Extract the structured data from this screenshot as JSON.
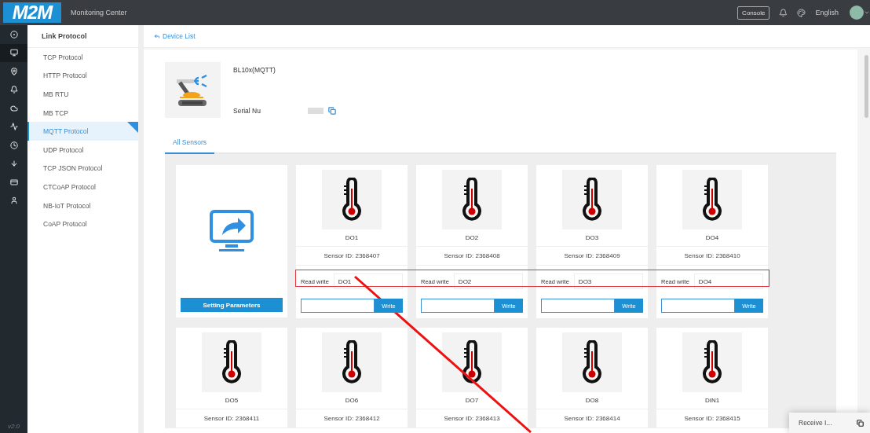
{
  "header": {
    "logo": "M2M",
    "title": "Monitoring Center",
    "console_button": "Console",
    "language": "English"
  },
  "rail": {
    "items": [
      {
        "selected": false
      },
      {
        "selected": true
      },
      {
        "selected": false
      },
      {
        "selected": false
      },
      {
        "selected": false
      },
      {
        "selected": false
      },
      {
        "selected": false
      },
      {
        "selected": false
      },
      {
        "selected": false
      },
      {
        "selected": false
      }
    ],
    "version": "v2.0"
  },
  "submenu": {
    "title": "Link Protocol",
    "items": [
      {
        "label": "TCP Protocol",
        "selected": false
      },
      {
        "label": "HTTP Protocol",
        "selected": false
      },
      {
        "label": "MB  RTU",
        "selected": false
      },
      {
        "label": "MB  TCP",
        "selected": false
      },
      {
        "label": "MQTT Protocol",
        "selected": true
      },
      {
        "label": "UDP Protocol",
        "selected": false
      },
      {
        "label": "TCP JSON Protocol",
        "selected": false
      },
      {
        "label": "CTCoAP Protocol",
        "selected": false
      },
      {
        "label": "NB-IoT Protocol",
        "selected": false
      },
      {
        "label": "CoAP Protocol",
        "selected": false
      }
    ]
  },
  "breadcrumb": {
    "back_link": "Device List"
  },
  "device": {
    "name": "BL10x(MQTT)",
    "serial_label": "Serial Nu"
  },
  "tabs": [
    {
      "label": "All Sensors",
      "selected": true
    }
  ],
  "setting_card": {
    "button": "Setting Parameters"
  },
  "sensors": [
    {
      "name": "DO1",
      "sensor_id_label": "Sensor ID:",
      "sensor_id": "2368407",
      "read_write_label": "Read write",
      "read_write_value": "DO1",
      "write_button": "Write"
    },
    {
      "name": "DO2",
      "sensor_id_label": "Sensor ID:",
      "sensor_id": "2368408",
      "read_write_label": "Read write",
      "read_write_value": "DO2",
      "write_button": "Write"
    },
    {
      "name": "DO3",
      "sensor_id_label": "Sensor ID:",
      "sensor_id": "2368409",
      "read_write_label": "Read write",
      "read_write_value": "DO3",
      "write_button": "Write"
    },
    {
      "name": "DO4",
      "sensor_id_label": "Sensor ID:",
      "sensor_id": "2368410",
      "read_write_label": "Read write",
      "read_write_value": "DO4",
      "write_button": "Write"
    },
    {
      "name": "DO5",
      "sensor_id_label": "Sensor ID:",
      "sensor_id": "2368411"
    },
    {
      "name": "DO6",
      "sensor_id_label": "Sensor ID:",
      "sensor_id": "2368412"
    },
    {
      "name": "DO7",
      "sensor_id_label": "Sensor ID:",
      "sensor_id": "2368413"
    },
    {
      "name": "DO8",
      "sensor_id_label": "Sensor ID:",
      "sensor_id": "2368414"
    },
    {
      "name": "DIN1",
      "sensor_id_label": "Sensor ID:",
      "sensor_id": "2368415"
    }
  ],
  "toast": {
    "text": "Receive I..."
  }
}
